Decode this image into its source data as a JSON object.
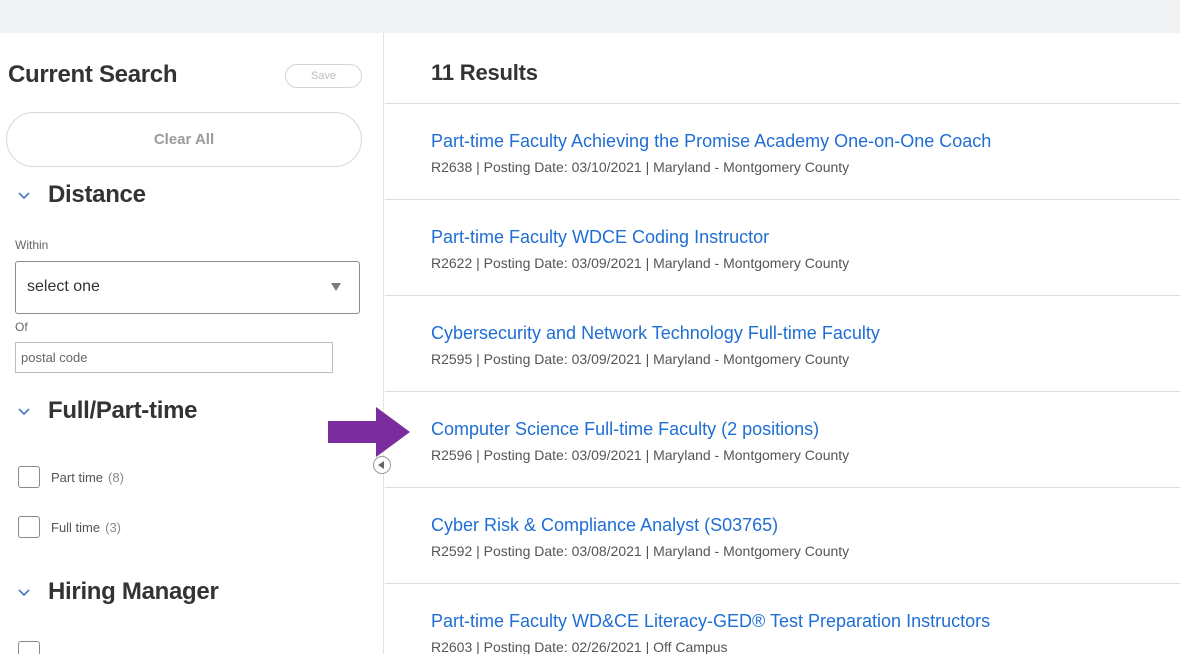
{
  "sidebar": {
    "title": "Current Search",
    "save_label": "Save",
    "clear_label": "Clear All",
    "sections": {
      "distance": {
        "title": "Distance",
        "within_label": "Within",
        "within_value": "select one",
        "of_label": "Of",
        "postal_placeholder": "postal code"
      },
      "fulltime": {
        "title": "Full/Part-time",
        "options": [
          {
            "label": "Part time",
            "count": "(8)"
          },
          {
            "label": "Full time",
            "count": "(3)"
          }
        ]
      },
      "hiring": {
        "title": "Hiring Manager"
      }
    }
  },
  "main": {
    "results_title": "11 Results",
    "results": [
      {
        "title": "Part-time Faculty Achieving the Promise Academy One-on-One Coach",
        "meta": "R2638  |  Posting Date: 03/10/2021  |  Maryland - Montgomery County"
      },
      {
        "title": "Part-time Faculty WDCE Coding Instructor",
        "meta": "R2622  |  Posting Date: 03/09/2021  |  Maryland - Montgomery County"
      },
      {
        "title": "Cybersecurity and Network Technology Full-time Faculty",
        "meta": "R2595  |  Posting Date: 03/09/2021  |  Maryland - Montgomery County"
      },
      {
        "title": "Computer Science Full-time Faculty (2 positions)",
        "meta": "R2596  |  Posting Date: 03/09/2021  |  Maryland - Montgomery County"
      },
      {
        "title": "Cyber Risk & Compliance Analyst (S03765)",
        "meta": "R2592  |  Posting Date: 03/08/2021  |  Maryland - Montgomery County"
      },
      {
        "title": "Part-time Faculty WD&CE Literacy-GED® Test Preparation Instructors",
        "meta": "R2603  |  Posting Date: 02/26/2021  |  Off Campus"
      }
    ]
  },
  "icons": {
    "chevron": "chevron-down-icon",
    "collapse": "collapse-left-icon",
    "annotation": "arrow-right-icon"
  },
  "colors": {
    "link": "#1f6ed4",
    "annotation_arrow": "#7b2c9e"
  }
}
